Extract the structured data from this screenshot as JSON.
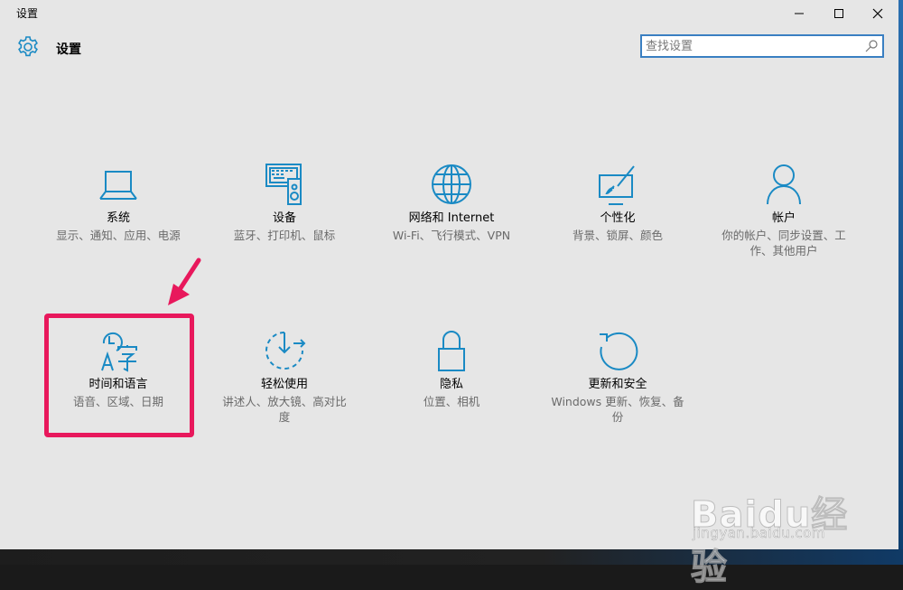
{
  "window": {
    "title": "设置",
    "minimize_icon": "minimize-icon",
    "maximize_icon": "maximize-icon",
    "close_icon": "close-icon"
  },
  "header": {
    "title": "设置",
    "icon": "gear-icon"
  },
  "search": {
    "placeholder": "查找设置",
    "icon": "search-icon"
  },
  "accent_color": "#1a8ac4",
  "highlight_color": "#e8185c",
  "tiles": [
    {
      "name": "系统",
      "desc": "显示、通知、应用、电源",
      "icon": "laptop-icon"
    },
    {
      "name": "设备",
      "desc": "蓝牙、打印机、鼠标",
      "icon": "devices-icon"
    },
    {
      "name": "网络和 Internet",
      "desc": "Wi-Fi、飞行模式、VPN",
      "icon": "globe-icon"
    },
    {
      "name": "个性化",
      "desc": "背景、锁屏、颜色",
      "icon": "personalization-icon"
    },
    {
      "name": "帐户",
      "desc": "你的帐户、同步设置、工作、其他用户",
      "icon": "person-icon"
    },
    {
      "name": "时间和语言",
      "desc": "语音、区域、日期",
      "icon": "time-language-icon"
    },
    {
      "name": "轻松使用",
      "desc": "讲述人、放大镜、高对比度",
      "icon": "ease-of-access-icon"
    },
    {
      "name": "隐私",
      "desc": "位置、相机",
      "icon": "lock-icon"
    },
    {
      "name": "更新和安全",
      "desc": "Windows 更新、恢复、备份",
      "icon": "refresh-icon"
    }
  ],
  "watermark": {
    "logo": "Baidu经验",
    "url": "jingyan.baidu.com"
  }
}
